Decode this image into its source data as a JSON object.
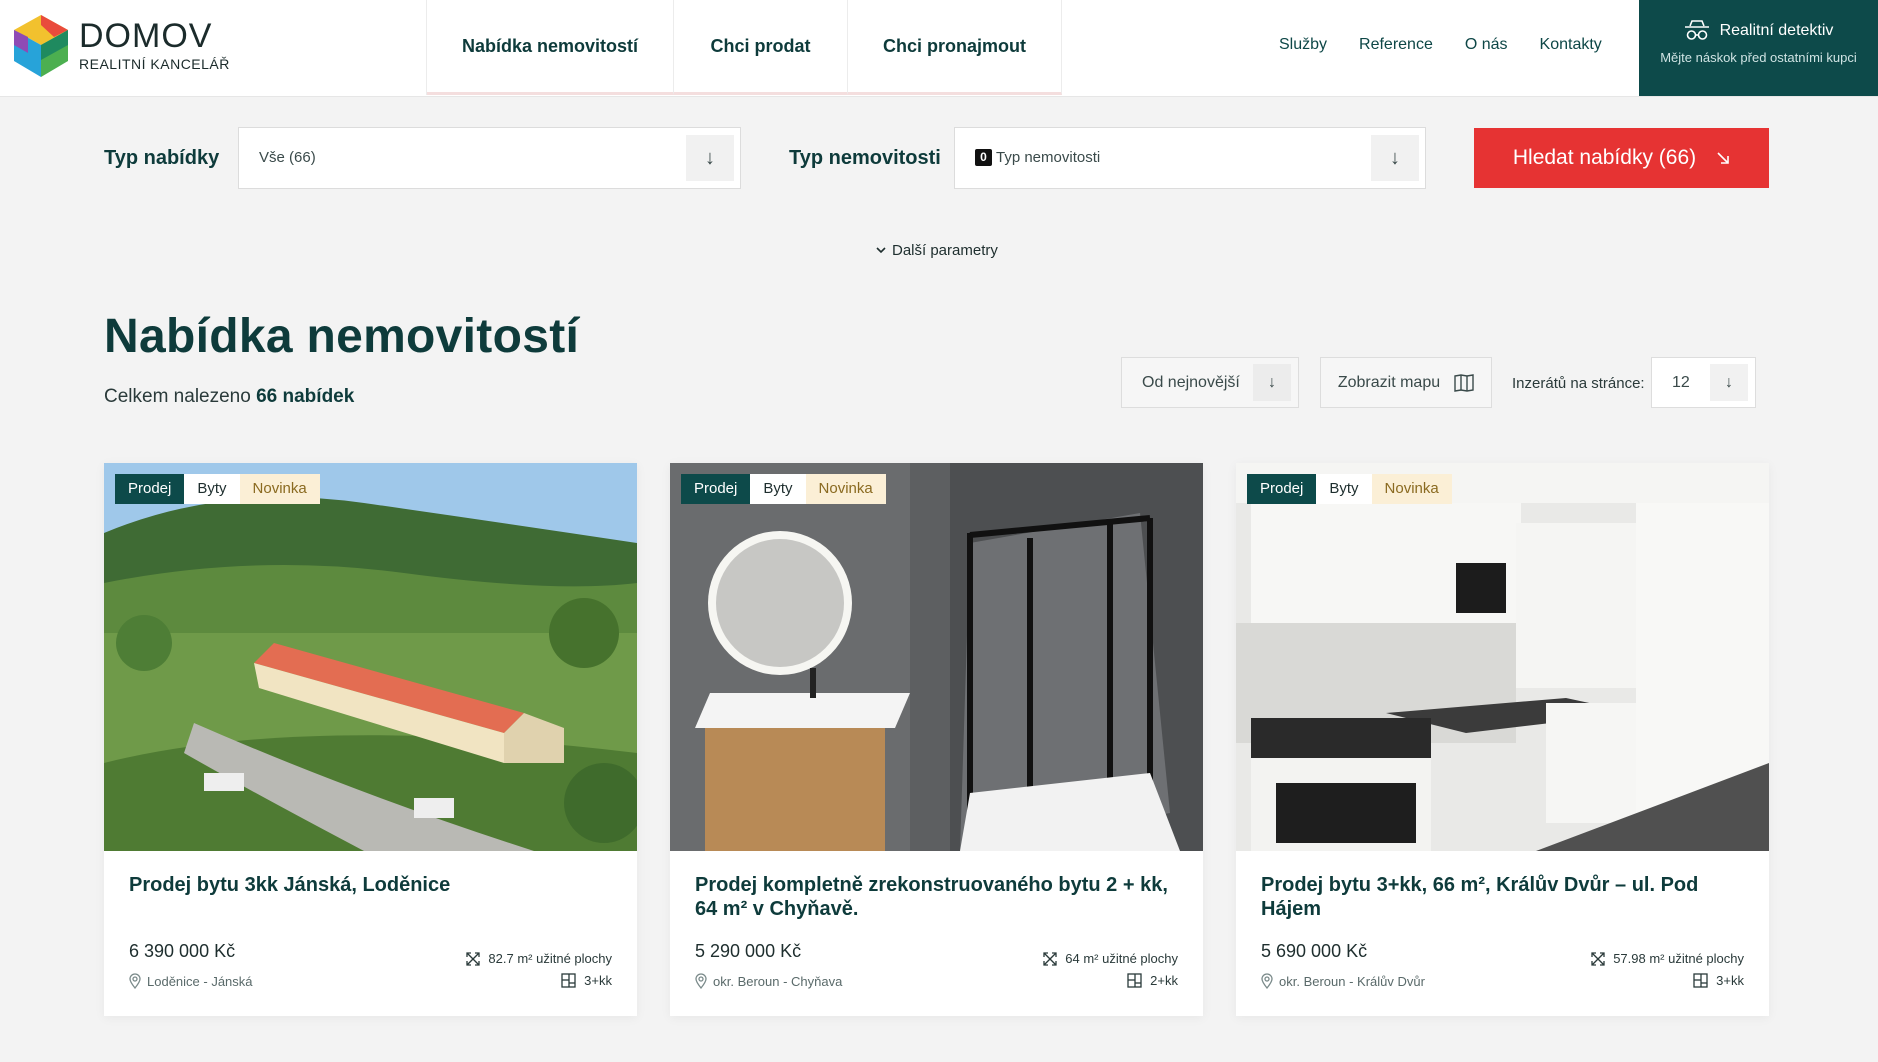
{
  "brand": {
    "name": "DOMOV",
    "subtitle": "REALITNÍ KANCELÁŘ"
  },
  "main_nav": [
    {
      "label": "Nabídka nemovitostí"
    },
    {
      "label": "Chci prodat"
    },
    {
      "label": "Chci pronajmout"
    }
  ],
  "top_nav": [
    {
      "label": "Služby"
    },
    {
      "label": "Reference"
    },
    {
      "label": "O nás"
    },
    {
      "label": "Kontakty"
    }
  ],
  "detective": {
    "title": "Realitní detektiv",
    "subtitle": "Mějte náskok před ostatními kupci"
  },
  "filters": {
    "offer_type_label": "Typ nabídky",
    "offer_type_value": "Vše (66)",
    "property_type_label": "Typ nemovitosti",
    "property_type_count": "0",
    "property_type_placeholder": "Typ nemovitosti",
    "search_button": "Hledat nabídky (66)",
    "more_params": "Další parametry"
  },
  "listing": {
    "title": "Nabídka nemovitostí",
    "count_prefix": "Celkem nalezeno",
    "count_value": "66 nabídek",
    "sort_value": "Od nejnovější",
    "map_button": "Zobrazit mapu",
    "per_page_label": "Inzerátů na stránce:",
    "per_page_value": "12"
  },
  "cards": [
    {
      "tags": [
        "Prodej",
        "Byty",
        "Novinka"
      ],
      "title": "Prodej bytu 3kk Jánská, Loděnice",
      "price": "6 390 000 Kč",
      "area": "82.7 m² užitné plochy",
      "location": "Loděnice - Jánská",
      "disposition": "3+kk"
    },
    {
      "tags": [
        "Prodej",
        "Byty",
        "Novinka"
      ],
      "title": "Prodej kompletně zrekonstruovaného bytu 2 + kk, 64 m² v Chyňavě.",
      "price": "5 290 000 Kč",
      "area": "64 m² užitné plochy",
      "location": "okr. Beroun - Chyňava",
      "disposition": "2+kk"
    },
    {
      "tags": [
        "Prodej",
        "Byty",
        "Novinka"
      ],
      "title": "Prodej bytu 3+kk, 66 m², Králův Dvůr – ul. Pod Hájem",
      "price": "5 690 000 Kč",
      "area": "57.98 m² užitné plochy",
      "location": "okr. Beroun - Králův Dvůr",
      "disposition": "3+kk"
    }
  ],
  "colors": {
    "primary": "#0d4a4a",
    "accent_red": "#e63333",
    "new_tag_bg": "#fbefd6",
    "background": "#f3f3f3"
  },
  "icons": [
    "logo-cube-icon",
    "detective-icon",
    "arrow-down-icon",
    "arrow-down-right-icon",
    "chevron-down-icon",
    "map-icon",
    "area-icon",
    "location-pin-icon",
    "floorplan-icon"
  ]
}
